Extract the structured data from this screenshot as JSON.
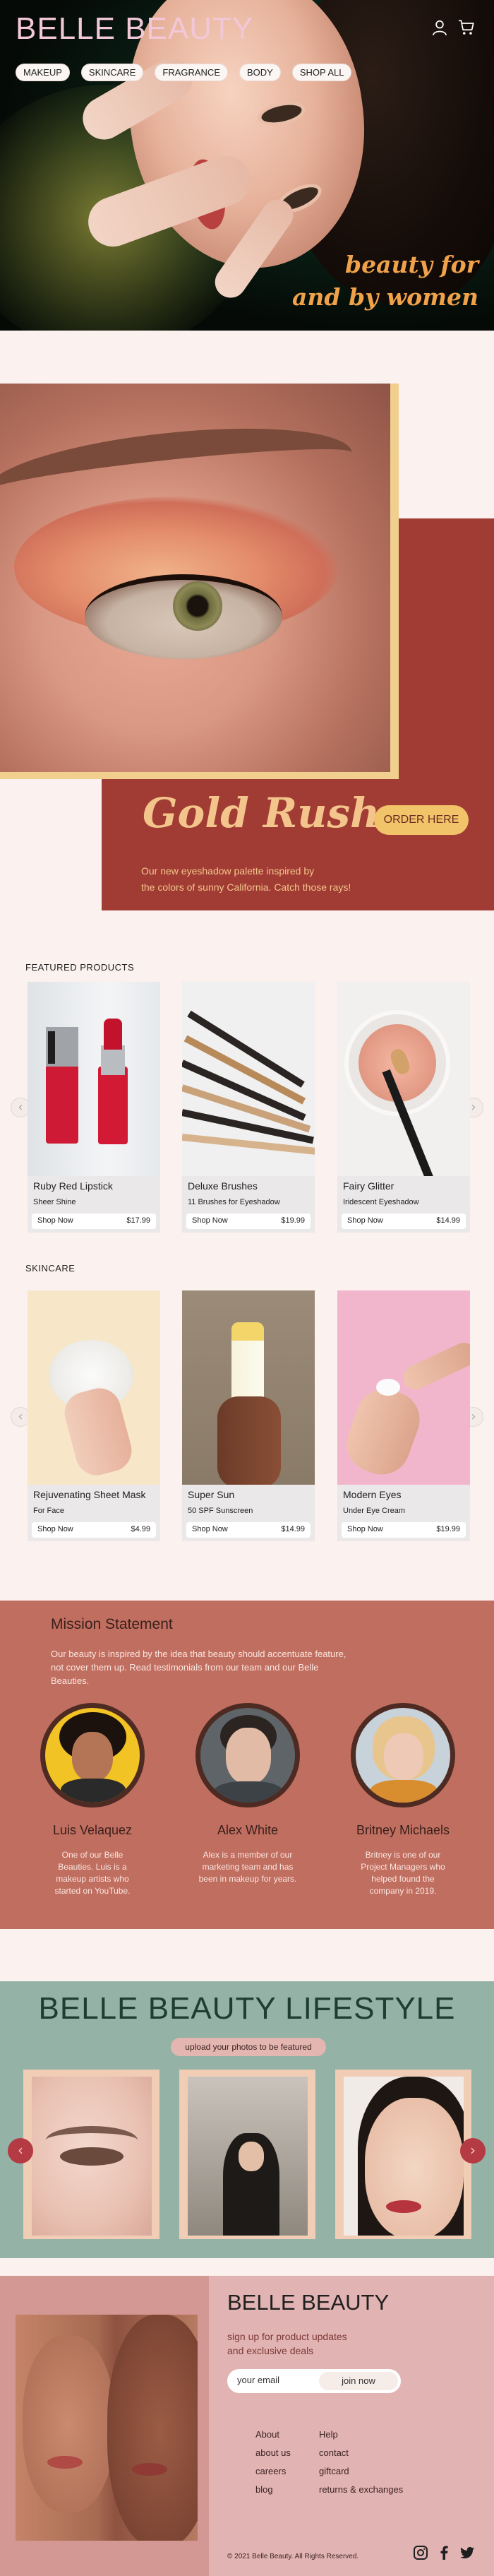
{
  "header": {
    "brand": "BELLE BEAUTY",
    "nav": [
      "MAKEUP",
      "SKINCARE",
      "FRAGRANCE",
      "BODY",
      "SHOP ALL"
    ],
    "tagline_line1": "beauty for",
    "tagline_line2": "and by women",
    "icons": [
      "user-icon",
      "cart-icon"
    ]
  },
  "promo": {
    "title": "Gold Rush",
    "cta": "ORDER HERE",
    "desc_line1": "Our new eyeshadow palette inspired by",
    "desc_line2": "the colors of sunny California. Catch those rays!"
  },
  "featured": {
    "label": "FEATURED PRODUCTS",
    "products": [
      {
        "name": "Ruby Red Lipstick",
        "sub": "Sheer Shine",
        "shop": "Shop Now",
        "price": "$17.99"
      },
      {
        "name": "Deluxe Brushes",
        "sub": "11 Brushes for Eyeshadow",
        "shop": "Shop Now",
        "price": "$19.99"
      },
      {
        "name": "Fairy Glitter",
        "sub": "Iridescent Eyeshadow",
        "shop": "Shop Now",
        "price": "$14.99"
      }
    ]
  },
  "skincare": {
    "label": "SKINCARE",
    "products": [
      {
        "name": "Rejuvenating Sheet Mask",
        "sub": "For Face",
        "shop": "Shop Now",
        "price": "$4.99"
      },
      {
        "name": "Super Sun",
        "sub": "50 SPF Sunscreen",
        "shop": "Shop Now",
        "price": "$14.99"
      },
      {
        "name": "Modern Eyes",
        "sub": "Under Eye Cream",
        "shop": "Shop Now",
        "price": "$19.99"
      }
    ]
  },
  "mission": {
    "title": "Mission Statement",
    "desc": "Our beauty is inspired by the idea that beauty should accentuate feature, not cover them up. Read testimonials from our team and our Belle Beauties.",
    "members": [
      {
        "name": "Luis Velaquez",
        "bio": "One of our Belle Beauties. Luis is a makeup artists who started on YouTube."
      },
      {
        "name": "Alex White",
        "bio": "Alex is a member of our marketing team and has been in makeup for years."
      },
      {
        "name": "Britney Michaels",
        "bio": "Britney is one of our Project Managers who helped found the company in 2019."
      }
    ]
  },
  "lifestyle": {
    "title": "BELLE BEAUTY LIFESTYLE",
    "upload": "upload your photos to be featured",
    "prev": "‹",
    "next": "›"
  },
  "footer": {
    "brand": "BELLE BEAUTY",
    "signup_line1": "sign up for product updates",
    "signup_line2": "and exclusive deals",
    "email_placeholder": "your email",
    "join": "join now",
    "links_col1": [
      "About",
      "about us",
      "careers",
      "blog"
    ],
    "links_col2": [
      "Help",
      "contact",
      "giftcard",
      "returns & exchanges"
    ],
    "copyright": "© 2021 Belle Beauty. All Rights Reserved.",
    "social": [
      "instagram-icon",
      "facebook-icon",
      "twitter-icon"
    ]
  },
  "colors": {
    "brand_pink": "#f2c7d8",
    "gold": "#f3c58c",
    "rust": "#a13c34",
    "mission_bg": "#c06e60",
    "lifestyle_bg": "#94b2a5",
    "footer_bg": "#e2b3b3"
  }
}
